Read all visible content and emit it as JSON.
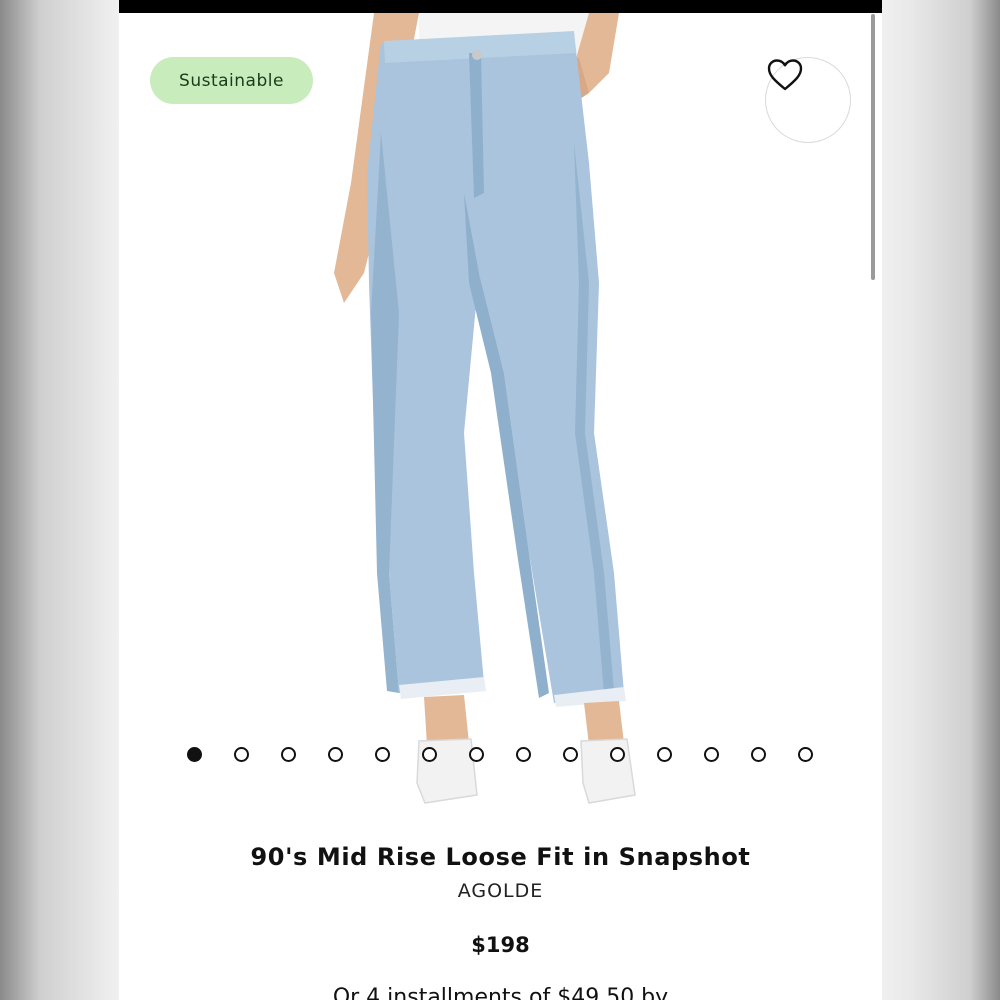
{
  "badge": {
    "label": "Sustainable"
  },
  "favorite": {
    "icon": "heart-outline-icon"
  },
  "carousel": {
    "total_images": 14,
    "active_index": 0
  },
  "product": {
    "name": "90's Mid Rise Loose Fit in Snapshot",
    "brand": "AGOLDE",
    "price": "$198"
  },
  "installments": {
    "text": "Or 4 installments of $49.50 by"
  },
  "colors": {
    "badge_bg": "#c9ecbd",
    "denim": "#a9c4dc",
    "text": "#111111"
  }
}
